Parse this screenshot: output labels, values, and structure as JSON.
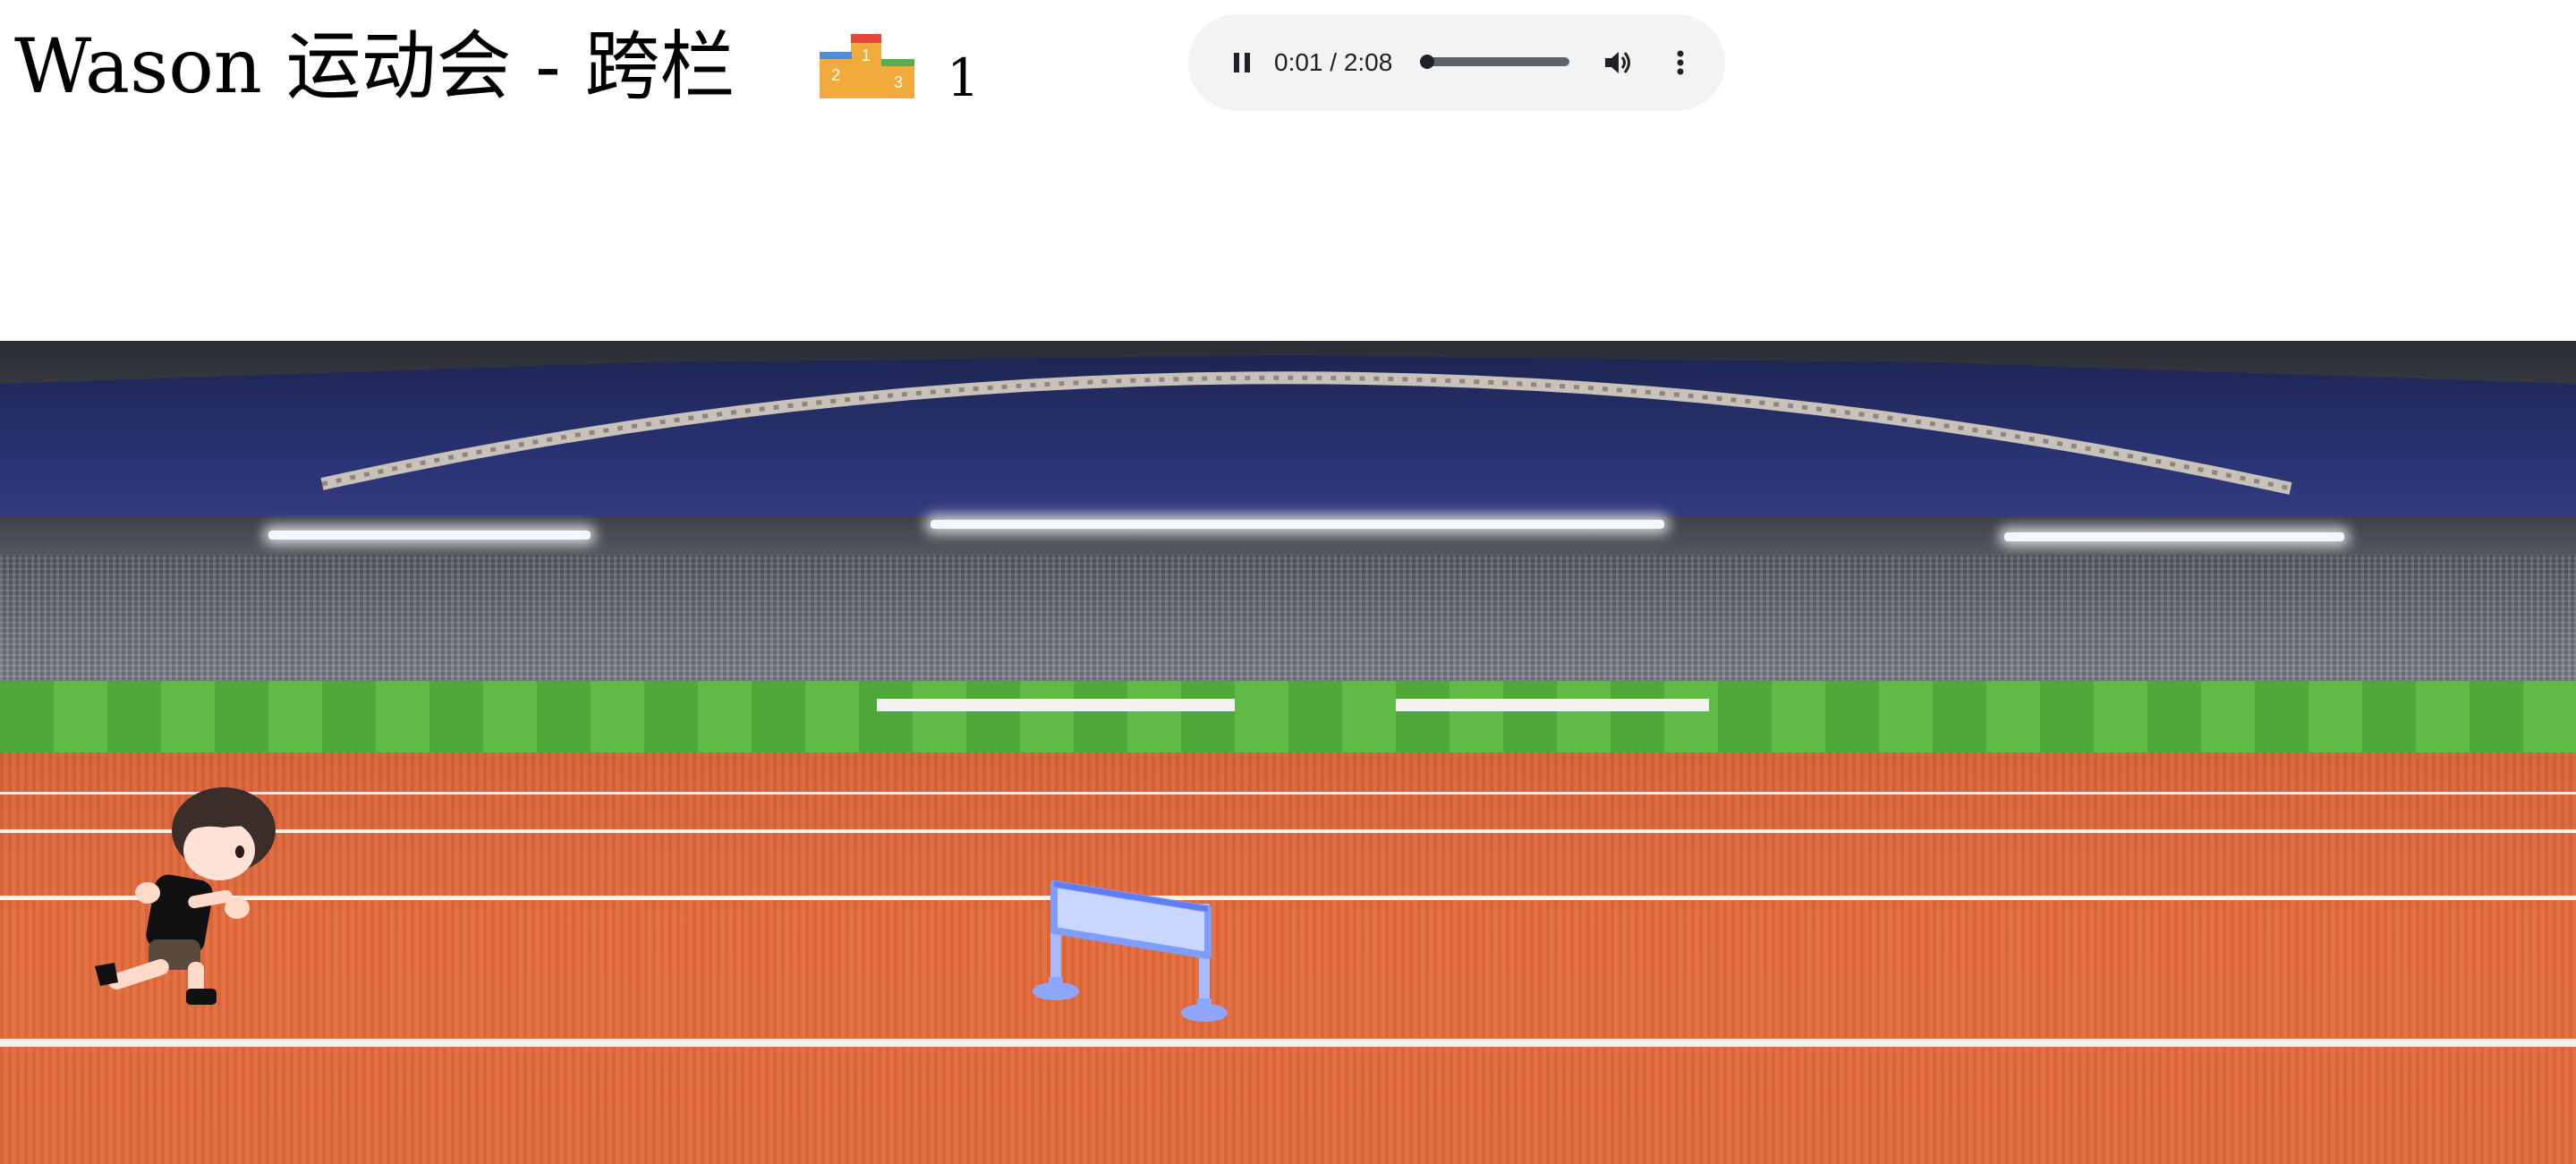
{
  "page": {
    "title": "Wason 运动会 - 跨栏"
  },
  "score": {
    "value": "1",
    "icon": "podium-icon",
    "podium_labels": [
      "1",
      "2",
      "3"
    ]
  },
  "audio": {
    "time_display": "0:01 / 2:08",
    "progress_fraction": 0.03,
    "state": "playing",
    "icons": {
      "pause": "pause-icon",
      "volume": "volume-icon",
      "more": "more-options-icon"
    }
  },
  "scene": {
    "background": "stadium",
    "track_color": "#e26a3b",
    "lane_line_color": "#f6f1ea",
    "hurdle_color": "#7f9cff",
    "player": "runner-character",
    "obstacle": "hurdle"
  }
}
